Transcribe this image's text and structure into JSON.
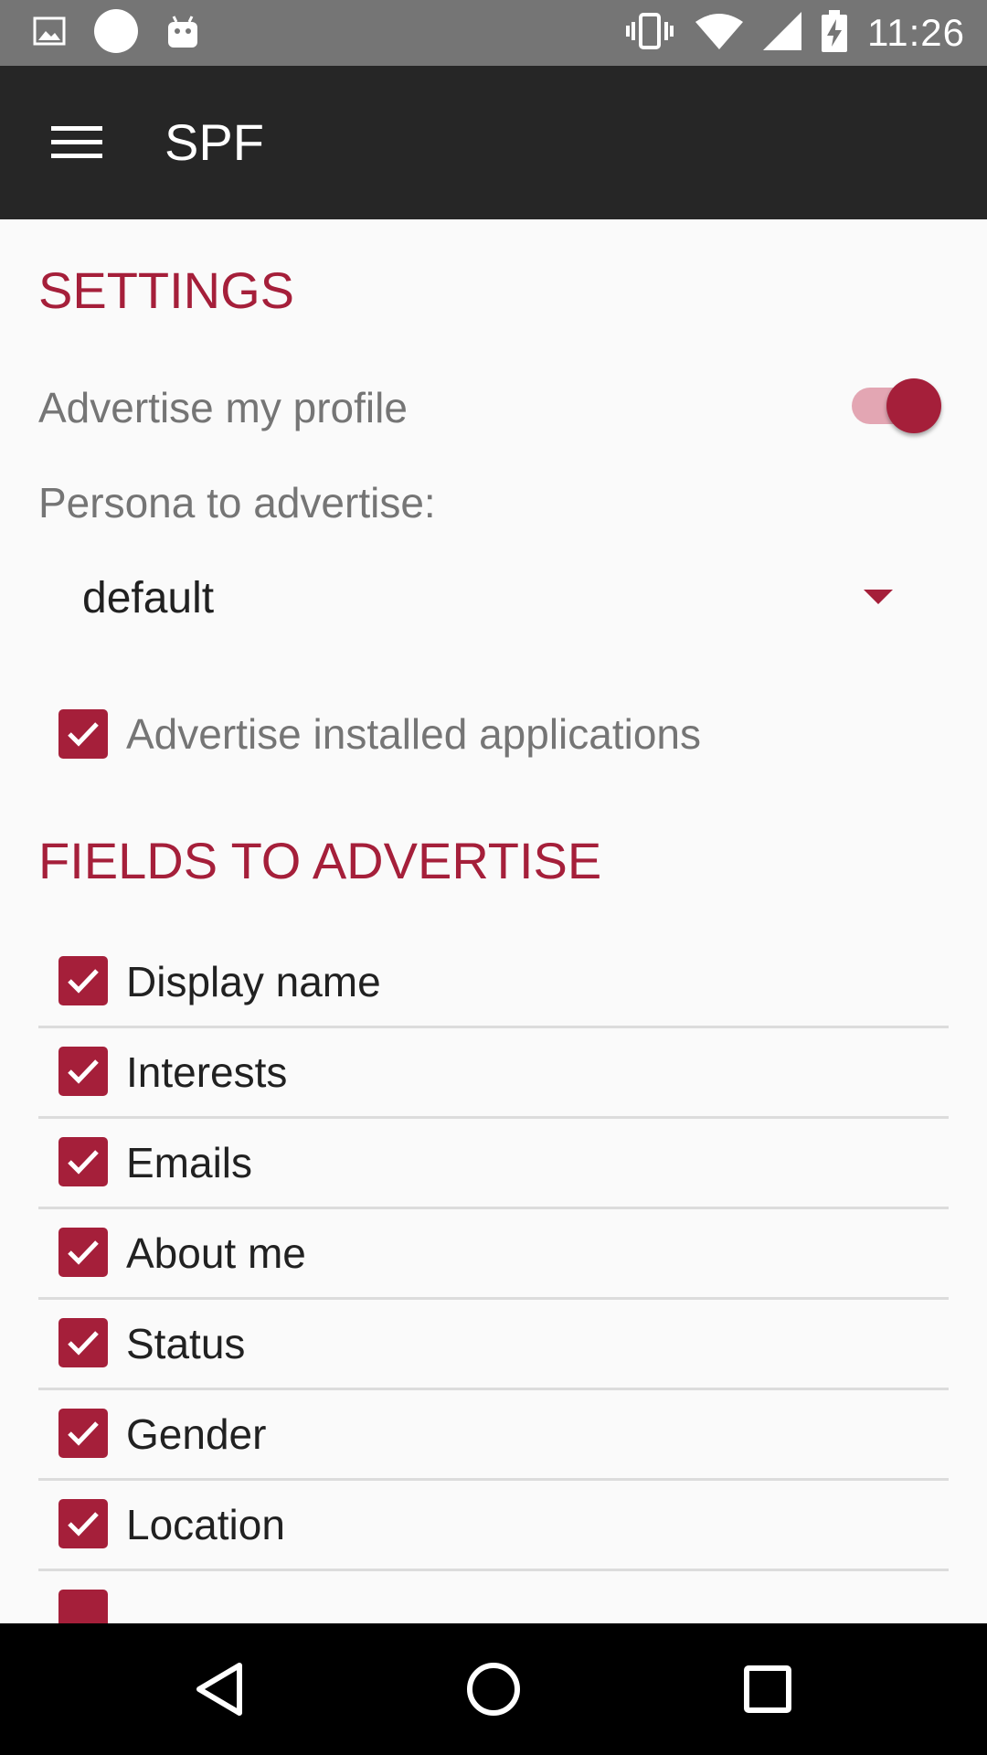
{
  "status_bar": {
    "time": "11:26",
    "icons": [
      "image-icon",
      "circle-icon",
      "android-icon",
      "vibrate-icon",
      "wifi-icon",
      "signal-icon",
      "battery-charging-icon"
    ]
  },
  "toolbar": {
    "title": "SPF",
    "menu_icon": "hamburger-menu-icon"
  },
  "settings": {
    "header": "SETTINGS",
    "advertise_profile": {
      "label": "Advertise my profile",
      "enabled": true
    },
    "persona_label": "Persona to advertise:",
    "persona_selected": "default",
    "advertise_apps": {
      "label": "Advertise installed applications",
      "checked": true
    }
  },
  "fields": {
    "header": "FIELDS TO ADVERTISE",
    "items": [
      {
        "label": "Display name",
        "checked": true
      },
      {
        "label": "Interests",
        "checked": true
      },
      {
        "label": "Emails",
        "checked": true
      },
      {
        "label": "About me",
        "checked": true
      },
      {
        "label": "Status",
        "checked": true
      },
      {
        "label": "Gender",
        "checked": true
      },
      {
        "label": "Location",
        "checked": true
      },
      {
        "label": "",
        "checked": true
      }
    ]
  },
  "nav_bar": {
    "back_icon": "back-triangle-icon",
    "home_icon": "home-circle-icon",
    "recents_icon": "recents-square-icon"
  },
  "colors": {
    "accent": "#a51f3a",
    "toolbar": "#262626",
    "status_bar": "#757575",
    "background": "#fafafa"
  }
}
